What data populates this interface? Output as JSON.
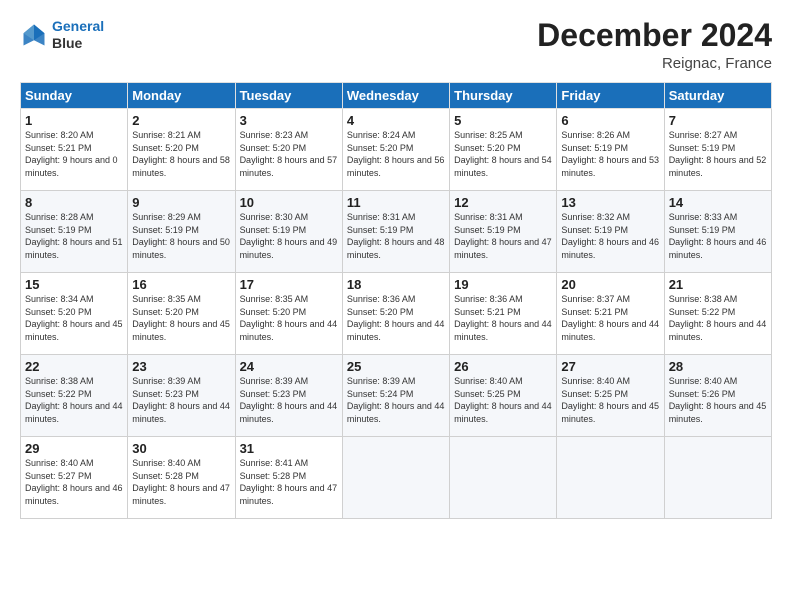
{
  "logo": {
    "line1": "General",
    "line2": "Blue"
  },
  "title": "December 2024",
  "location": "Reignac, France",
  "days_of_week": [
    "Sunday",
    "Monday",
    "Tuesday",
    "Wednesday",
    "Thursday",
    "Friday",
    "Saturday"
  ],
  "weeks": [
    [
      {
        "day": "1",
        "sunrise": "8:20 AM",
        "sunset": "5:21 PM",
        "daylight": "9 hours and 0 minutes."
      },
      {
        "day": "2",
        "sunrise": "8:21 AM",
        "sunset": "5:20 PM",
        "daylight": "8 hours and 58 minutes."
      },
      {
        "day": "3",
        "sunrise": "8:23 AM",
        "sunset": "5:20 PM",
        "daylight": "8 hours and 57 minutes."
      },
      {
        "day": "4",
        "sunrise": "8:24 AM",
        "sunset": "5:20 PM",
        "daylight": "8 hours and 56 minutes."
      },
      {
        "day": "5",
        "sunrise": "8:25 AM",
        "sunset": "5:20 PM",
        "daylight": "8 hours and 54 minutes."
      },
      {
        "day": "6",
        "sunrise": "8:26 AM",
        "sunset": "5:19 PM",
        "daylight": "8 hours and 53 minutes."
      },
      {
        "day": "7",
        "sunrise": "8:27 AM",
        "sunset": "5:19 PM",
        "daylight": "8 hours and 52 minutes."
      }
    ],
    [
      {
        "day": "8",
        "sunrise": "8:28 AM",
        "sunset": "5:19 PM",
        "daylight": "8 hours and 51 minutes."
      },
      {
        "day": "9",
        "sunrise": "8:29 AM",
        "sunset": "5:19 PM",
        "daylight": "8 hours and 50 minutes."
      },
      {
        "day": "10",
        "sunrise": "8:30 AM",
        "sunset": "5:19 PM",
        "daylight": "8 hours and 49 minutes."
      },
      {
        "day": "11",
        "sunrise": "8:31 AM",
        "sunset": "5:19 PM",
        "daylight": "8 hours and 48 minutes."
      },
      {
        "day": "12",
        "sunrise": "8:31 AM",
        "sunset": "5:19 PM",
        "daylight": "8 hours and 47 minutes."
      },
      {
        "day": "13",
        "sunrise": "8:32 AM",
        "sunset": "5:19 PM",
        "daylight": "8 hours and 46 minutes."
      },
      {
        "day": "14",
        "sunrise": "8:33 AM",
        "sunset": "5:19 PM",
        "daylight": "8 hours and 46 minutes."
      }
    ],
    [
      {
        "day": "15",
        "sunrise": "8:34 AM",
        "sunset": "5:20 PM",
        "daylight": "8 hours and 45 minutes."
      },
      {
        "day": "16",
        "sunrise": "8:35 AM",
        "sunset": "5:20 PM",
        "daylight": "8 hours and 45 minutes."
      },
      {
        "day": "17",
        "sunrise": "8:35 AM",
        "sunset": "5:20 PM",
        "daylight": "8 hours and 44 minutes."
      },
      {
        "day": "18",
        "sunrise": "8:36 AM",
        "sunset": "5:20 PM",
        "daylight": "8 hours and 44 minutes."
      },
      {
        "day": "19",
        "sunrise": "8:36 AM",
        "sunset": "5:21 PM",
        "daylight": "8 hours and 44 minutes."
      },
      {
        "day": "20",
        "sunrise": "8:37 AM",
        "sunset": "5:21 PM",
        "daylight": "8 hours and 44 minutes."
      },
      {
        "day": "21",
        "sunrise": "8:38 AM",
        "sunset": "5:22 PM",
        "daylight": "8 hours and 44 minutes."
      }
    ],
    [
      {
        "day": "22",
        "sunrise": "8:38 AM",
        "sunset": "5:22 PM",
        "daylight": "8 hours and 44 minutes."
      },
      {
        "day": "23",
        "sunrise": "8:39 AM",
        "sunset": "5:23 PM",
        "daylight": "8 hours and 44 minutes."
      },
      {
        "day": "24",
        "sunrise": "8:39 AM",
        "sunset": "5:23 PM",
        "daylight": "8 hours and 44 minutes."
      },
      {
        "day": "25",
        "sunrise": "8:39 AM",
        "sunset": "5:24 PM",
        "daylight": "8 hours and 44 minutes."
      },
      {
        "day": "26",
        "sunrise": "8:40 AM",
        "sunset": "5:25 PM",
        "daylight": "8 hours and 44 minutes."
      },
      {
        "day": "27",
        "sunrise": "8:40 AM",
        "sunset": "5:25 PM",
        "daylight": "8 hours and 45 minutes."
      },
      {
        "day": "28",
        "sunrise": "8:40 AM",
        "sunset": "5:26 PM",
        "daylight": "8 hours and 45 minutes."
      }
    ],
    [
      {
        "day": "29",
        "sunrise": "8:40 AM",
        "sunset": "5:27 PM",
        "daylight": "8 hours and 46 minutes."
      },
      {
        "day": "30",
        "sunrise": "8:40 AM",
        "sunset": "5:28 PM",
        "daylight": "8 hours and 47 minutes."
      },
      {
        "day": "31",
        "sunrise": "8:41 AM",
        "sunset": "5:28 PM",
        "daylight": "8 hours and 47 minutes."
      },
      null,
      null,
      null,
      null
    ]
  ]
}
